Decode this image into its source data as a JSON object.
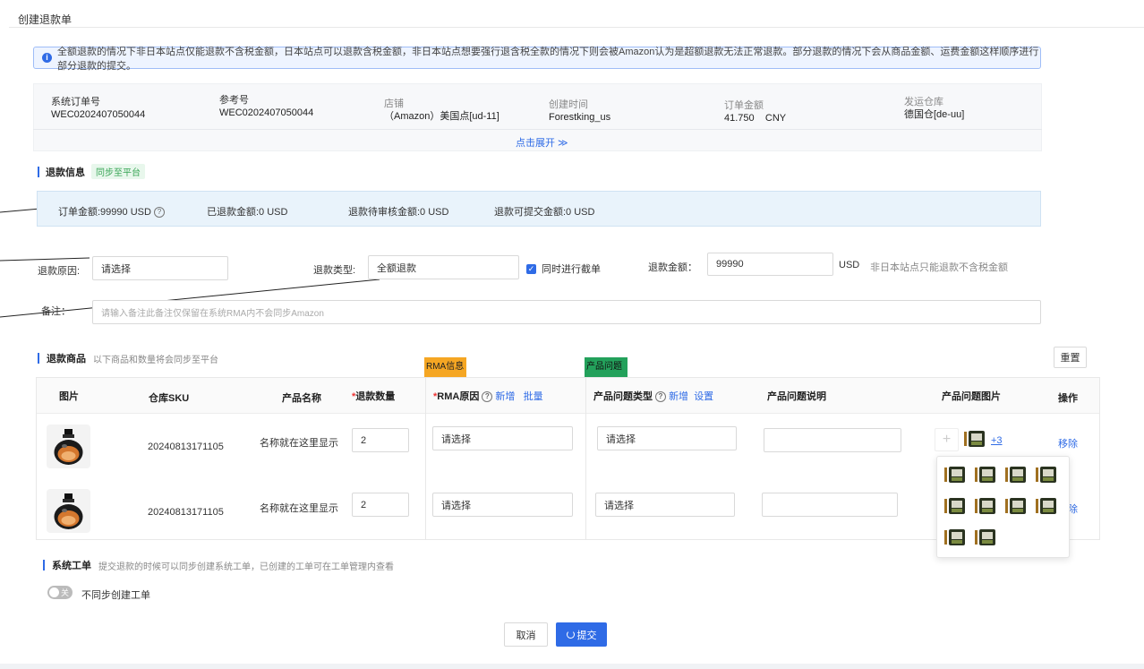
{
  "page": {
    "title": "创建退款单"
  },
  "notice": {
    "text": "全额退款的情况下非日本站点仅能退款不含税金额，日本站点可以退款含税金额，非日本站点想要强行退含税全款的情况下则会被Amazon认为是超额退款无法正常退款。部分退款的情况下会从商品金额、运费金额这样顺序进行部分退款的提交。"
  },
  "order": {
    "sys_no_label": "系统订单号",
    "sys_no": "WEC0202407050044",
    "ref_label": "参考号",
    "ref": "WEC0202407050044",
    "shop_label": "店铺",
    "shop": "（Amazon）美国点[ud-11]",
    "created_label": "创建时间",
    "created": "Forestking_us",
    "amount_label": "订单金额",
    "amount": "41.750",
    "currency": "CNY",
    "warehouse_label": "发运仓库",
    "warehouse": "德国仓[de-uu]",
    "expand_label": "点击展开 ≫"
  },
  "refund_info": {
    "title": "退款信息",
    "sync_tag": "同步至平台",
    "order_amount": "订单金额:99990 USD",
    "refunded": "已退款金额:0 USD",
    "pending": "退款待审核金额:0 USD",
    "submittable": "退款可提交金额:0 USD"
  },
  "form": {
    "reason_label": "退款原因:",
    "reason_value": "请选择",
    "type_label": "退款类型:",
    "type_value": "全额退款",
    "intercept_label": "同时进行截单",
    "amount_label": "退款金额：",
    "amount_value": "99990",
    "currency": "USD",
    "amount_hint": "非日本站点只能退款不含税金额",
    "note_label": "备注：",
    "note_placeholder": "请输入备注此备注仅保留在系统RMA内不会同步Amazon"
  },
  "products": {
    "title": "退款商品",
    "hint": "以下商品和数量将会同步至平台",
    "reset_label": "重置",
    "rma_tag": "RMA信息",
    "prod_tag": "产品问题",
    "headers": {
      "image": "图片",
      "sku": "仓库SKU",
      "name": "产品名称",
      "qty": "退款数量",
      "rma_reason": "RMA原因",
      "rma_add": "新增",
      "rma_batch": "批量",
      "issue_type": "产品问题类型",
      "issue_add": "新增",
      "issue_set": "设置",
      "issue_desc": "产品问题说明",
      "issue_pic": "产品问题图片",
      "action": "操作"
    },
    "rows": [
      {
        "sku": "20240813171105",
        "name": "名称就在这里显示",
        "qty": "2",
        "rma": "请选择",
        "issue": "请选择",
        "more": "+3",
        "remove": "移除"
      },
      {
        "sku": "20240813171105",
        "name": "名称就在这里显示",
        "qty": "2",
        "rma": "请选择",
        "issue": "请选择",
        "remove": "除"
      }
    ]
  },
  "ticket": {
    "title": "系统工单",
    "hint": "提交退款的时候可以同步创建系统工单，已创建的工单可在工单管理内查看",
    "toggle_text": "关",
    "toggle_label": "不同步创建工单"
  },
  "footer": {
    "cancel": "取消",
    "submit": "提交"
  },
  "colors": {
    "primary": "#2f6be6",
    "rma_tag": "#f5a623",
    "prod_tag": "#23a15b"
  }
}
